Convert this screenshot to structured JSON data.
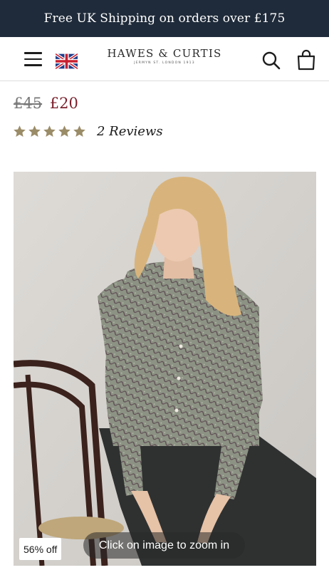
{
  "banner": {
    "text": "Free UK Shipping on orders over £175"
  },
  "header": {
    "brand_name": "HAWES & CURTIS",
    "brand_tagline": "JERMYN ST. LONDON 1913",
    "menu_icon": "hamburger-menu-icon",
    "flag_icon": "uk-flag-icon",
    "search_icon": "search-icon",
    "bag_icon": "shopping-bag-icon"
  },
  "product": {
    "old_price": "£45",
    "price": "£20",
    "rating": 5,
    "reviews_label": "2 Reviews",
    "discount_badge": "56% off",
    "zoom_hint": "Click on image to zoom in"
  },
  "colors": {
    "banner_bg": "#1f2b3a",
    "price_sale": "#7a1f2b",
    "star": "#9b8c68"
  }
}
